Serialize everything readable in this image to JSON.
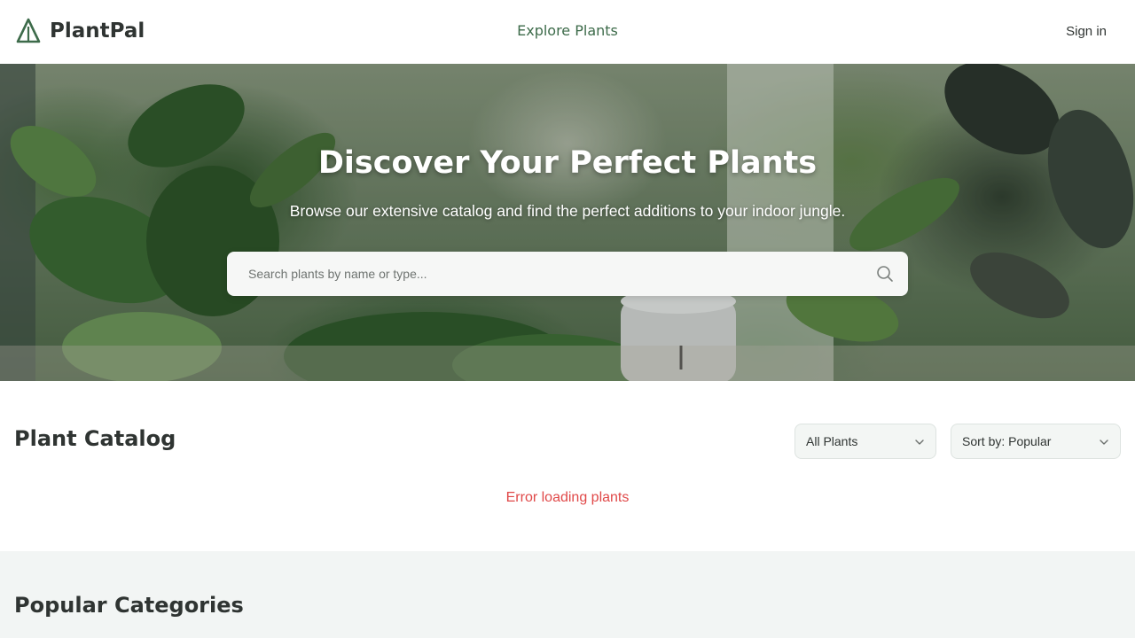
{
  "header": {
    "brand": "PlantPal",
    "nav_explore": "Explore Plants",
    "sign_in": "Sign in"
  },
  "hero": {
    "title": "Discover Your Perfect Plants",
    "subtitle": "Browse our extensive catalog and find the perfect additions to your indoor jungle.",
    "search_placeholder": "Search plants by name or type..."
  },
  "catalog": {
    "title": "Plant Catalog",
    "filter_value": "All Plants",
    "sort_value": "Sort by: Popular",
    "error": "Error loading plants"
  },
  "categories": {
    "title": "Popular Categories"
  },
  "colors": {
    "brand_green": "#3d6b4a",
    "error_red": "#e04848",
    "section_bg": "#f2f5f4"
  },
  "icons": {
    "logo": "plant-logo-icon",
    "search": "search-icon",
    "dropdown": "chevron-down-icon"
  }
}
